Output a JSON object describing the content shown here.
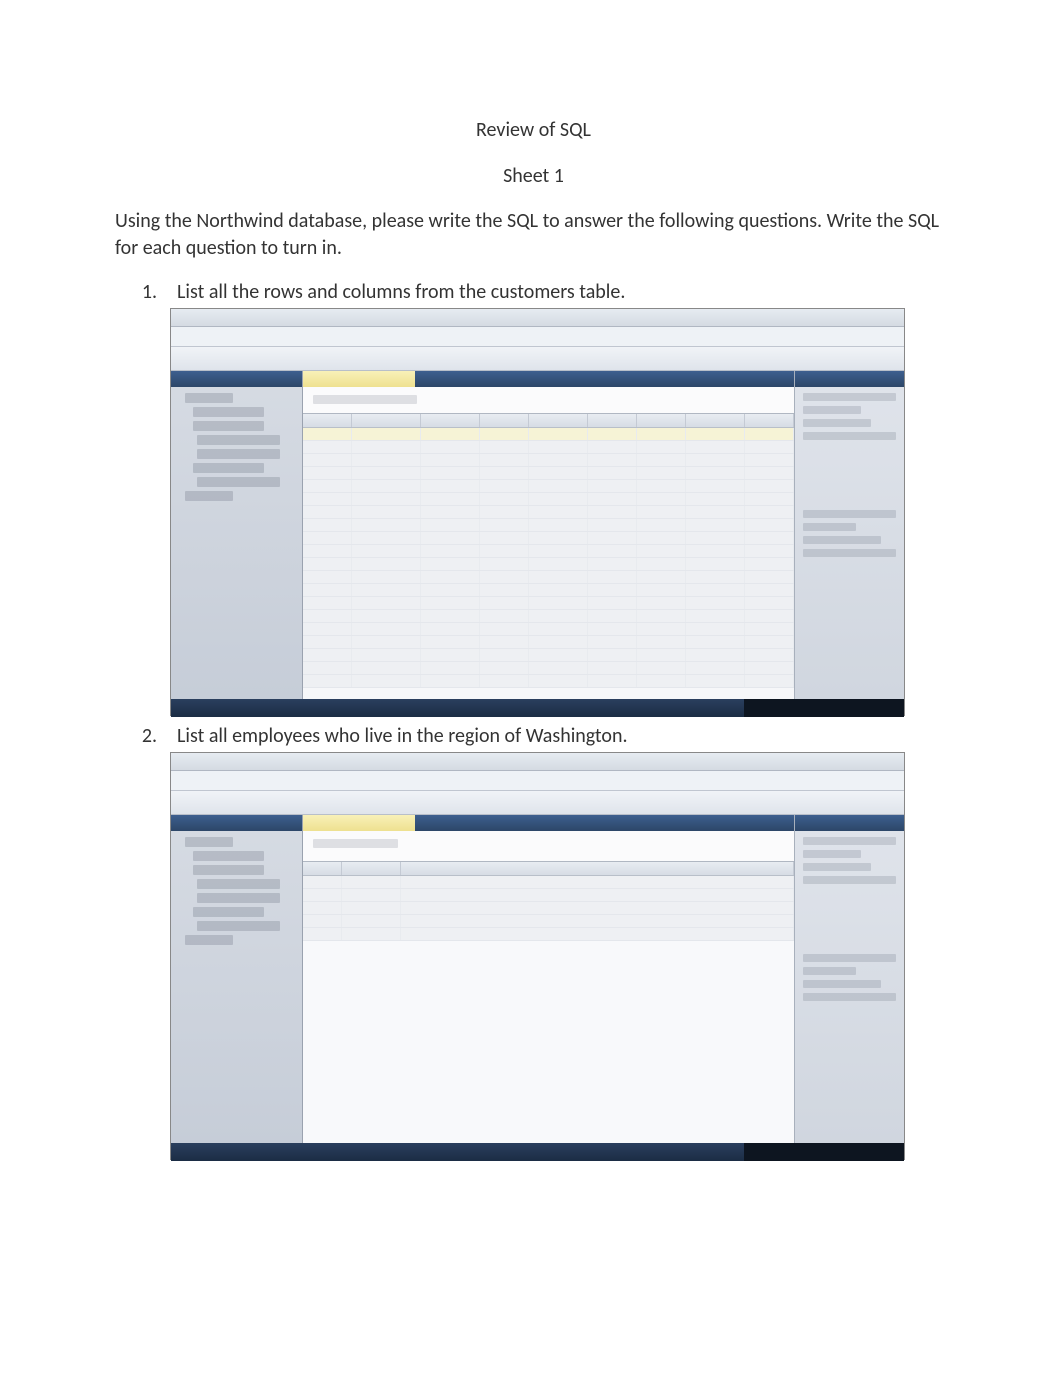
{
  "title": "Review of SQL",
  "subtitle": "Sheet 1",
  "intro": "Using the Northwind database, please write the SQL to answer the following questions.  Write the SQL for each question to turn in.",
  "questions": [
    {
      "num": "1.",
      "text": "List all the rows and columns from the customers table."
    },
    {
      "num": "2.",
      "text": "List all employees who live in the region of Washington."
    }
  ]
}
